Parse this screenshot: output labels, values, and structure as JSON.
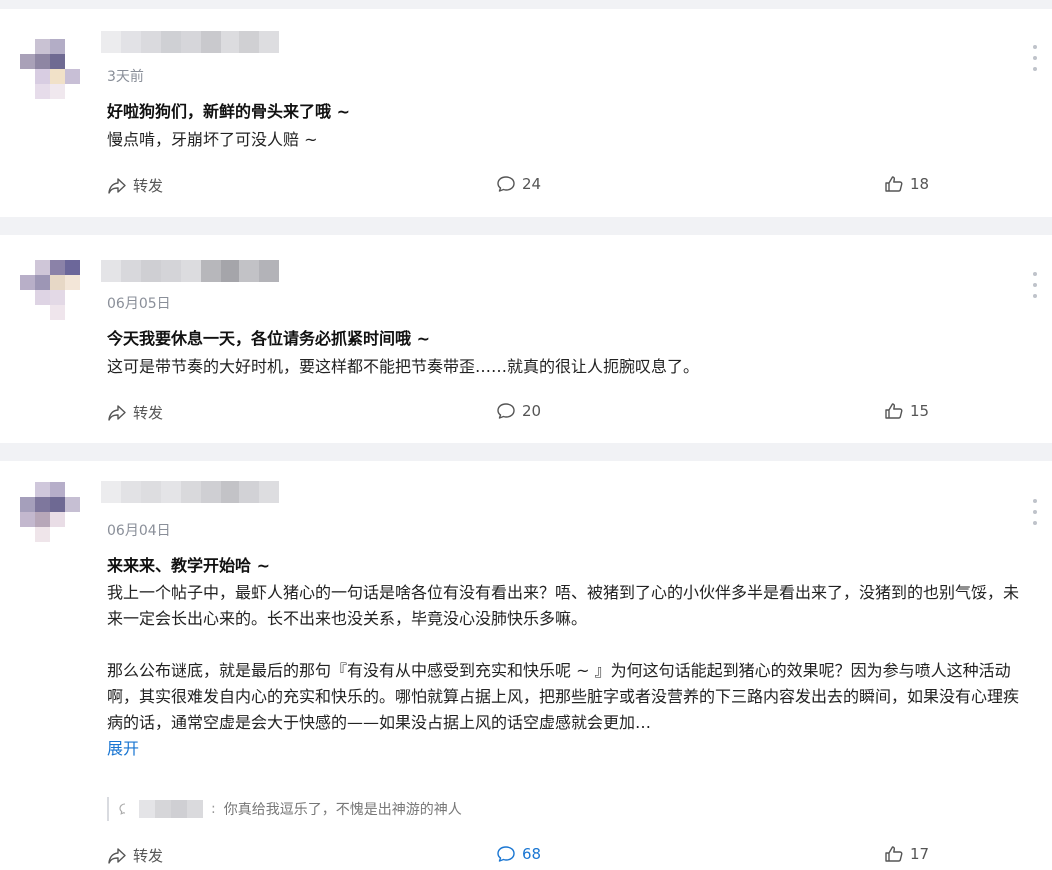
{
  "posts": [
    {
      "time": "3天前",
      "title": "好啦狗狗们，新鲜的骨头来了哦 ~",
      "paragraphs": [
        "慢点啃，牙崩坏了可没人赔 ~"
      ],
      "share_label": "转发",
      "comments": "24",
      "likes": "18"
    },
    {
      "time": "06月05日",
      "title": "今天我要休息一天，各位请务必抓紧时间哦 ~",
      "paragraphs": [
        "这可是带节奏的大好时机，要这样都不能把节奏带歪……就真的很让人扼腕叹息了。"
      ],
      "share_label": "转发",
      "comments": "20",
      "likes": "15"
    },
    {
      "time": "06月04日",
      "title": "来来来、教学开始哈 ~",
      "paragraphs": [
        "我上一个帖子中，最虾人猪心的一句话是啥各位有没有看出来？唔、被猪到了心的小伙伴多半是看出来了，没猪到的也别气馁，未来一定会长出心来的。长不出来也没关系，毕竟没心没肺快乐多嘛。",
        "那么公布谜底，就是最后的那句『有没有从中感受到充实和快乐呢 ~ 』为何这句话能起到猪心的效果呢？因为参与喷人这种活动啊，其实很难发自内心的充实和快乐的。哪怕就算占据上风，把那些脏字或者没营养的下三路内容发出去的瞬间，如果没有心理疾病的话，通常空虚是会大于快感的——如果没占据上风的话空虚感就会更加…"
      ],
      "expand_label": "展开",
      "reply_text": "你真给我逗乐了，不愧是出神游的神人",
      "share_label": "转发",
      "comments": "68",
      "likes": "17"
    }
  ],
  "colors": {
    "accent": "#1a76d2",
    "page_bg": "#f1f2f5",
    "card_bg": "#ffffff"
  },
  "icons": {
    "share": "share-arrow-icon",
    "comment": "comment-bubble-icon",
    "like": "thumbs-up-icon",
    "more": "more-vertical-icon",
    "reply": "reply-bubble-icon"
  }
}
